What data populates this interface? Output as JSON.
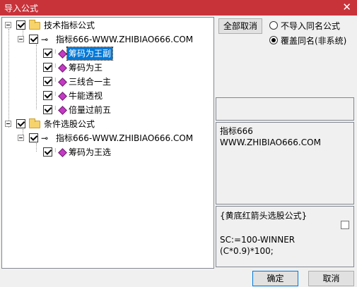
{
  "window": {
    "title": "导入公式",
    "close": "✕"
  },
  "tree": {
    "groups": [
      {
        "label": "技术指标公式",
        "child": {
          "label": "指标666-WWW.ZHIBIAO666.COM",
          "items": [
            "筹码为王副",
            "筹码为王",
            "三线合一主",
            "牛能透视",
            "倍量过前五"
          ]
        }
      },
      {
        "label": "条件选股公式",
        "child": {
          "label": "指标666-WWW.ZHIBIAO666.COM",
          "items": [
            "筹码为王选"
          ]
        }
      }
    ]
  },
  "controls": {
    "cancel_all": "全部取消",
    "radio_no_import": "不导入同名公式",
    "radio_overwrite": "覆盖同名(非系统)",
    "selected_radio": "overwrite"
  },
  "info_panel": {
    "line1": "指标666",
    "line2": "WWW.ZHIBIAO666.COM"
  },
  "formula_panel": {
    "title": "{黄底红箭头选股公式}",
    "code": "SC:=100-WINNER\n(C*0.9)*100;"
  },
  "footer": {
    "ok": "确定",
    "cancel": "取消"
  },
  "colors": {
    "titlebar": "#c8333a",
    "selection": "#0078d7",
    "diamond": "#c43ac4"
  }
}
